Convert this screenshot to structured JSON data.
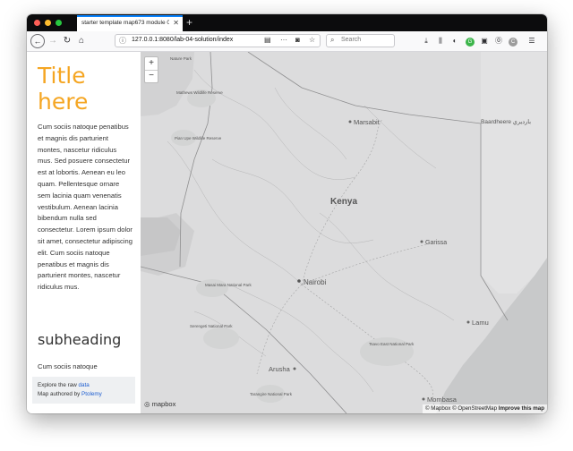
{
  "browser": {
    "tab_title": "starter template map673 module 0",
    "tab_close": "✕",
    "new_tab": "+",
    "url": "127.0.0.1:8080/lab-04-solution/index",
    "search_placeholder": "Search"
  },
  "sidebar": {
    "title": "Title here",
    "paragraph1": "Cum sociis natoque penatibus et magnis dis parturient montes, nascetur ridiculus mus. Sed posuere consectetur est at lobortis. Aenean eu leo quam. Pellentesque ornare sem lacinia quam venenatis vestibulum. Aenean lacinia bibendum nulla sed consectetur. Lorem ipsum dolor sit amet, consectetur adipiscing elit. Cum sociis natoque penatibus et magnis dis parturient montes, nascetur ridiculus mus.",
    "subheading": "subheading",
    "paragraph2": "Cum sociis natoque",
    "footer": {
      "raw_prefix": "Explore the raw",
      "raw_link": "data",
      "author_prefix": "Map authored by",
      "author_link": "Ptolemy"
    }
  },
  "map": {
    "zoom_in": "+",
    "zoom_out": "−",
    "labels": {
      "kenya": "Kenya",
      "marsabit": "Marsabit",
      "baardheere": "Baardheere بارديري",
      "garissa": "Garissa",
      "nairobi": "Nairobi",
      "lamu": "Lamu",
      "arusha": "Arusha",
      "mombasa": "Mombasa",
      "mathews": "Mathews Wildlife Reserve",
      "nature_park": "Nature Park",
      "pian_upe": "Pian Upe Wildlife Reserve",
      "masai_mara": "Masai Mara National Park",
      "serengeti": "Serengeti National Park",
      "tsavo_east": "Tsavo East National Park",
      "tarangire": "Tarangire National Park"
    },
    "logo": "mapbox",
    "attribution": {
      "mapbox": "© Mapbox",
      "osm": "© OpenStreetMap",
      "improve": "Improve this map"
    }
  }
}
